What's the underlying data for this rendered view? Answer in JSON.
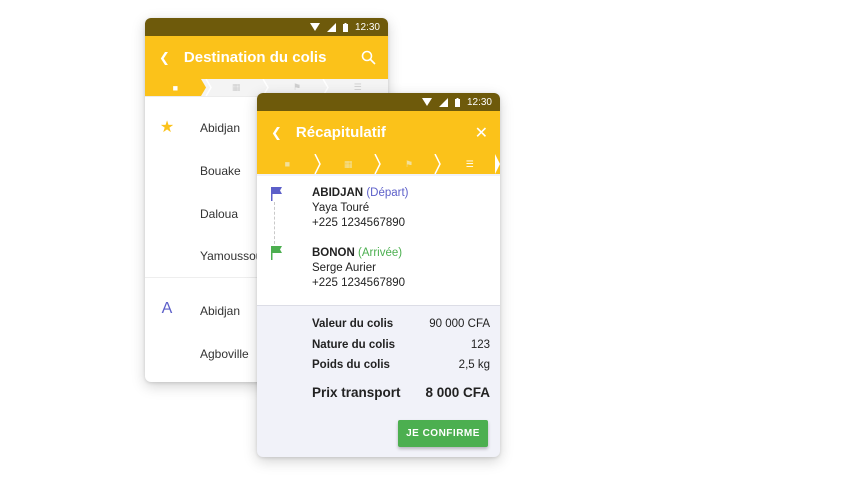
{
  "colors": {
    "accent": "#fbc21a",
    "statusbar": "#6e5a0b",
    "depart": "#5c5fc9",
    "arrive": "#4caf50",
    "button": "#4caf50"
  },
  "back_screen": {
    "status_time": "12:30",
    "title": "Destination du colis",
    "back_icon": "chevron-left-icon",
    "search_icon": "search-icon",
    "favorites_icon": "star-icon",
    "favorites": [
      "Abidjan",
      "Bouake",
      "Daloua",
      "Yamoussoukro"
    ],
    "section_letter": "A",
    "cities_a": [
      "Abidjan",
      "Agboville"
    ]
  },
  "front_screen": {
    "status_time": "12:30",
    "title": "Récapitulatif",
    "back_icon": "chevron-left-icon",
    "close_icon": "close-icon",
    "steps": [
      "chat-icon",
      "calendar-icon",
      "flag-icon",
      "coins-icon"
    ],
    "departure": {
      "city": "ABIDJAN",
      "tag": "(Départ)",
      "name": "Yaya Touré",
      "phone": "+225 1234567890"
    },
    "arrival": {
      "city": "BONON",
      "tag": "(Arrivée)",
      "name": "Serge Aurier",
      "phone": "+225 1234567890"
    },
    "details": [
      {
        "label": "Valeur du colis",
        "value": "90 000 CFA"
      },
      {
        "label": "Nature du colis",
        "value": "123"
      },
      {
        "label": "Poids du colis",
        "value": "2,5 kg"
      }
    ],
    "total": {
      "label": "Prix transport",
      "value": "8 000 CFA"
    },
    "confirm_label": "JE CONFIRME"
  }
}
